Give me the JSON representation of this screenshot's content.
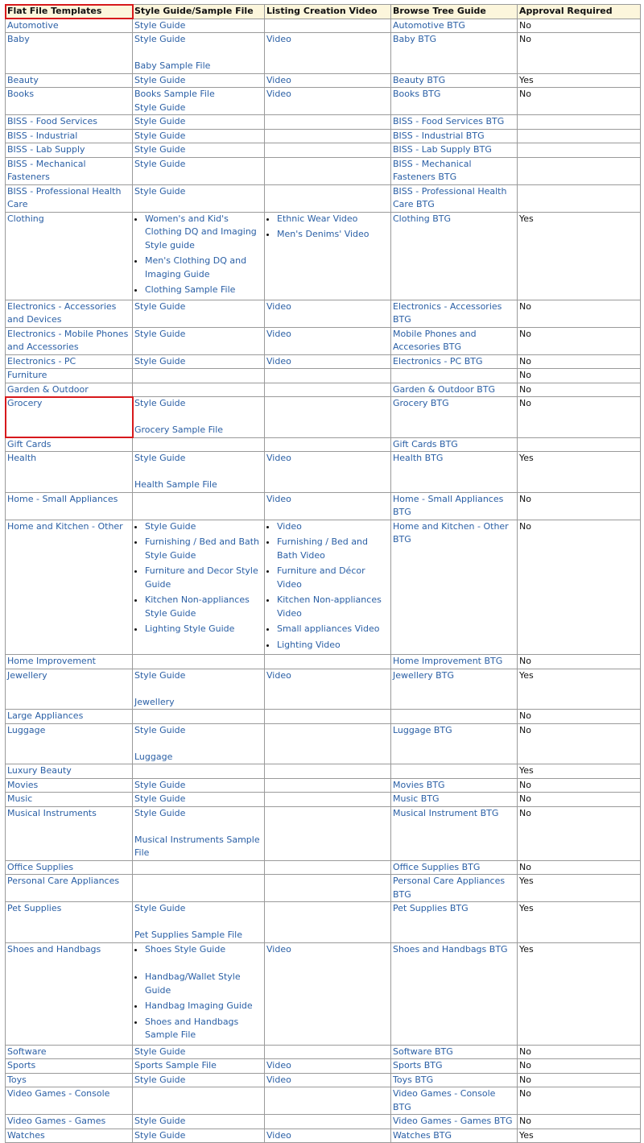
{
  "headers": [
    "Flat File Templates",
    "Style Guide/Sample File",
    "Listing Creation Video",
    "Browse Tree Guide",
    "Approval Required"
  ],
  "rows": [
    {
      "category": "Automotive",
      "style": {
        "links": [
          "Style Guide"
        ]
      },
      "video": {
        "links": []
      },
      "btg": "Automotive BTG",
      "approval": "No"
    },
    {
      "category": "Baby",
      "style": {
        "links": [
          "Style Guide",
          "",
          "Baby Sample File"
        ]
      },
      "video": {
        "links": [
          "Video"
        ]
      },
      "btg": "Baby BTG",
      "approval": "No"
    },
    {
      "category": "Beauty",
      "style": {
        "links": [
          "Style Guide"
        ]
      },
      "video": {
        "links": [
          "Video"
        ]
      },
      "btg": "Beauty BTG",
      "approval": "Yes"
    },
    {
      "category": "Books",
      "style": {
        "links": [
          "Books Sample File",
          "Style Guide"
        ]
      },
      "video": {
        "links": [
          "Video"
        ]
      },
      "btg": "Books BTG",
      "approval": "No"
    },
    {
      "category": "BISS - Food Services",
      "style": {
        "links": [
          "Style Guide"
        ]
      },
      "video": {
        "links": []
      },
      "btg": "BISS - Food Services BTG",
      "approval": ""
    },
    {
      "category": "BISS - Industrial",
      "style": {
        "links": [
          "Style Guide"
        ]
      },
      "video": {
        "links": []
      },
      "btg": "BISS - Industrial BTG",
      "approval": ""
    },
    {
      "category": "BISS - Lab Supply",
      "style": {
        "links": [
          "Style Guide"
        ]
      },
      "video": {
        "links": []
      },
      "btg": "BISS - Lab Supply BTG",
      "approval": ""
    },
    {
      "category": "BISS - Mechanical Fasteners",
      "style": {
        "links": [
          "Style Guide"
        ]
      },
      "video": {
        "links": []
      },
      "btg": "BISS - Mechanical Fasteners BTG",
      "approval": ""
    },
    {
      "category": "BISS - Professional Health Care",
      "style": {
        "links": [
          "Style Guide"
        ]
      },
      "video": {
        "links": []
      },
      "btg": "BISS - Professional Health Care BTG",
      "approval": ""
    },
    {
      "category": "Clothing",
      "style": {
        "bullets": [
          "Women's and Kid's Clothing DQ and Imaging Style guide",
          "Men's Clothing DQ and Imaging Guide",
          "Clothing Sample File"
        ]
      },
      "video": {
        "bullets": [
          "Ethnic Wear Video",
          "Men's Denims' Video"
        ]
      },
      "btg": "Clothing BTG",
      "approval": "Yes"
    },
    {
      "category": "Electronics - Accessories and Devices",
      "style": {
        "links": [
          "Style Guide"
        ]
      },
      "video": {
        "links": [
          "Video"
        ]
      },
      "btg": "Electronics - Accessories BTG",
      "approval": "No"
    },
    {
      "category": "Electronics - Mobile Phones and Accessories",
      "style": {
        "links": [
          "Style Guide"
        ]
      },
      "video": {
        "links": [
          "Video"
        ]
      },
      "btg": "Mobile Phones and Accesories BTG",
      "approval": "No"
    },
    {
      "category": "Electronics - PC",
      "style": {
        "links": [
          "Style Guide"
        ]
      },
      "video": {
        "links": [
          "Video"
        ]
      },
      "btg": "Electronics - PC BTG",
      "approval": "No"
    },
    {
      "category": "Furniture",
      "style": {
        "links": []
      },
      "video": {
        "links": []
      },
      "btg": "",
      "approval": "No"
    },
    {
      "category": "Garden & Outdoor",
      "style": {
        "links": []
      },
      "video": {
        "links": []
      },
      "btg": "Garden & Outdoor BTG",
      "approval": "No"
    },
    {
      "category": "Grocery",
      "style": {
        "links": [
          "Style Guide",
          "",
          "Grocery Sample File"
        ]
      },
      "video": {
        "links": []
      },
      "btg": "Grocery BTG",
      "approval": "No"
    },
    {
      "category": "Gift Cards",
      "style": {
        "links": []
      },
      "video": {
        "links": []
      },
      "btg": "Gift Cards BTG",
      "approval": ""
    },
    {
      "category": "Health",
      "style": {
        "links": [
          "Style Guide",
          "",
          "Health Sample File"
        ]
      },
      "video": {
        "links": [
          "Video"
        ]
      },
      "btg": "Health BTG",
      "approval": "Yes"
    },
    {
      "category": "Home - Small Appliances",
      "style": {
        "links": []
      },
      "video": {
        "links": [
          "Video"
        ]
      },
      "btg": "Home - Small Appliances BTG",
      "approval": "No"
    },
    {
      "category": "Home and Kitchen - Other",
      "style": {
        "bullets": [
          "Style Guide",
          "Furnishing / Bed and Bath Style Guide",
          "Furniture and Decor Style Guide",
          "Kitchen Non-appliances Style Guide",
          "Lighting Style Guide"
        ]
      },
      "video": {
        "bullets": [
          "Video",
          "Furnishing / Bed and Bath Video",
          "Furniture and Décor Video",
          "Kitchen Non-appliances Video",
          "Small appliances Video",
          "Lighting Video"
        ]
      },
      "btg": "Home and Kitchen - Other BTG",
      "approval": "No"
    },
    {
      "category": "Home Improvement",
      "style": {
        "links": []
      },
      "video": {
        "links": []
      },
      "btg": "Home Improvement BTG",
      "approval": "No"
    },
    {
      "category": "Jewellery",
      "style": {
        "links": [
          "Style Guide",
          "",
          "Jewellery"
        ]
      },
      "video": {
        "links": [
          "Video"
        ]
      },
      "btg": "Jewellery BTG",
      "approval": "Yes"
    },
    {
      "category": "Large Appliances",
      "style": {
        "links": []
      },
      "video": {
        "links": []
      },
      "btg": "",
      "approval": "No"
    },
    {
      "category": "Luggage",
      "style": {
        "links": [
          "Style Guide",
          "",
          "Luggage"
        ]
      },
      "video": {
        "links": []
      },
      "btg": "Luggage BTG",
      "approval": "No"
    },
    {
      "category": "Luxury Beauty",
      "style": {
        "links": []
      },
      "video": {
        "links": []
      },
      "btg": "",
      "approval": "Yes"
    },
    {
      "category": "Movies",
      "style": {
        "links": [
          "Style Guide"
        ]
      },
      "video": {
        "links": []
      },
      "btg": "Movies BTG",
      "approval": "No"
    },
    {
      "category": "Music",
      "style": {
        "links": [
          "Style Guide"
        ]
      },
      "video": {
        "links": []
      },
      "btg": "Music BTG",
      "approval": "No"
    },
    {
      "category": "Musical Instruments",
      "style": {
        "links": [
          "Style Guide",
          "",
          "Musical Instruments Sample File"
        ]
      },
      "video": {
        "links": []
      },
      "btg": "Musical Instrument BTG",
      "approval": "No"
    },
    {
      "category": "Office Supplies",
      "style": {
        "links": []
      },
      "video": {
        "links": []
      },
      "btg": "Office Supplies BTG",
      "approval": "No"
    },
    {
      "category": "Personal Care Appliances",
      "style": {
        "links": []
      },
      "video": {
        "links": []
      },
      "btg": "Personal Care Appliances BTG",
      "approval": "Yes"
    },
    {
      "category": "Pet Supplies",
      "style": {
        "links": [
          "Style Guide",
          "",
          "Pet Supplies Sample File"
        ]
      },
      "video": {
        "links": []
      },
      "btg": "Pet Supplies BTG",
      "approval": "Yes"
    },
    {
      "category": "Shoes and Handbags",
      "style": {
        "bullets": [
          "Shoes Style Guide",
          "Handbag/Wallet Style Guide",
          "Handbag Imaging Guide",
          "Shoes and Handbags Sample File"
        ],
        "gap_after_first": true
      },
      "video": {
        "links": [
          "Video"
        ]
      },
      "btg": "Shoes and Handbags BTG",
      "approval": "Yes"
    },
    {
      "category": "Software",
      "style": {
        "links": [
          "Style Guide"
        ]
      },
      "video": {
        "links": []
      },
      "btg": "Software BTG",
      "approval": "No"
    },
    {
      "category": "Sports",
      "style": {
        "links": [
          "Sports Sample File"
        ]
      },
      "video": {
        "links": [
          "Video"
        ]
      },
      "btg": "Sports BTG",
      "approval": "No"
    },
    {
      "category": "Toys",
      "style": {
        "links": [
          "Style Guide"
        ]
      },
      "video": {
        "links": [
          "Video"
        ]
      },
      "btg": "Toys BTG",
      "approval": "No"
    },
    {
      "category": "Video Games - Console",
      "style": {
        "links": []
      },
      "video": {
        "links": []
      },
      "btg": "Video Games - Console BTG",
      "approval": "No"
    },
    {
      "category": "Video Games - Games",
      "style": {
        "links": [
          "Style Guide"
        ]
      },
      "video": {
        "links": []
      },
      "btg": "Video Games - Games BTG",
      "approval": "No"
    },
    {
      "category": "Watches",
      "style": {
        "links": [
          "Style Guide"
        ]
      },
      "video": {
        "links": [
          "Video"
        ]
      },
      "btg": "Watches BTG",
      "approval": "Yes"
    }
  ],
  "colors": {
    "link": "#2a5fa5",
    "header_bg": "#fcf6dc",
    "border": "#9a9a9a",
    "highlight": "#d7191c"
  },
  "highlights": [
    "header:Flat File Templates",
    "cell:Grocery"
  ]
}
